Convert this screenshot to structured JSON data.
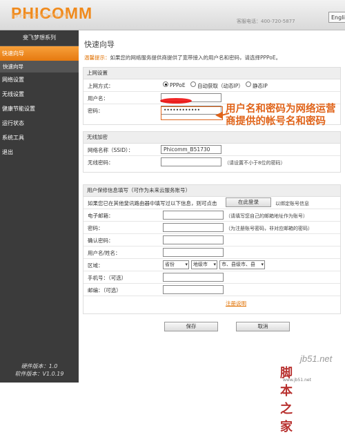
{
  "header": {
    "logo": "PHICOMM",
    "logo_reflection": "PHICOMM",
    "hotline": "客服电话：400-720-5877",
    "lang_button": "English"
  },
  "sidebar": {
    "title": "斐飞梦想系列",
    "items": [
      {
        "label": "快速向导",
        "active": true
      },
      {
        "label": "快速向导",
        "sub": true
      },
      {
        "label": "网络设置"
      },
      {
        "label": "无线设置"
      },
      {
        "label": "健康节能设置"
      },
      {
        "label": "运行状态"
      },
      {
        "label": "系统工具"
      },
      {
        "label": "退出"
      }
    ],
    "hardware_version": "硬件版本：1.0",
    "software_version": "软件版本：V1.0.19"
  },
  "main": {
    "title": "快速向导",
    "tip_label": "温馨提示：",
    "tip_text": "如果您的网络服务提供商提供了宽带接入的用户名和密码，请选择PPPoE。",
    "internet": {
      "header": "上网设置",
      "mode_label": "上网方式：",
      "modes": [
        "PPPoE",
        "自动获取（动态IP）",
        "静态IP"
      ],
      "selected_mode": "PPPoE",
      "username_label": "用户名：",
      "username_value": "",
      "password_label": "密码：",
      "password_value": "••••••••••••"
    },
    "wireless": {
      "header": "无线加密",
      "ssid_label": "网络名称（SSID）：",
      "ssid_value": "Phicomm_B51730",
      "password_label": "无线密码：",
      "password_value": "",
      "password_hint": "（请设置不小于8位的密码）"
    },
    "account": {
      "header": "用户保修信息填写（可作为未来云服务账号）",
      "login_prompt": "如果您已在其他斐讯路由器中填写过以下信息，则可点击",
      "login_button": "在此登录",
      "login_suffix": "以绑定账号信息",
      "email_label": "电子邮箱：",
      "email_hint": "（请填写您自己的邮箱地址作为账号）",
      "password_label": "密码：",
      "password_hint": "（为注册账号密码，非对应邮箱的密码）",
      "confirm_label": "确认密码：",
      "username_label": "用户名/姓名：",
      "region_label": "区域：",
      "region_province": "省份",
      "region_city": "地级市",
      "region_county": "市、县级市、县",
      "phone_label": "手机号：（可选）",
      "mail_label": "邮编：（可选）",
      "register_link": "注册说明"
    },
    "save_button": "保存",
    "cancel_button": "取消"
  },
  "annotation": {
    "text": "用户名和密码为网络运营商提供的帐号名和密码"
  },
  "watermark": {
    "line1": "jb51.net",
    "line2": "脚本之家",
    "line3": "www.jb51.net"
  },
  "colors": {
    "accent": "#f08a1c",
    "annotation": "#e0641a",
    "sidebar_bg": "#3b3b3b"
  }
}
